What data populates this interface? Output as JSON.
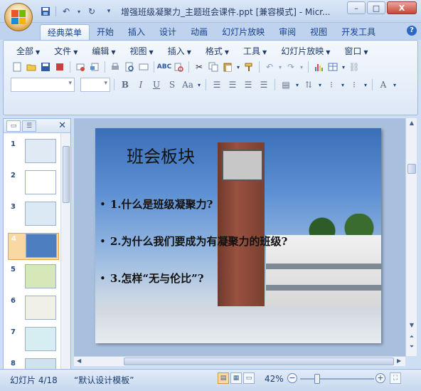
{
  "window": {
    "title": "增强班级凝聚力_主题班会课件.ppt [兼容模式] - Micr...",
    "min_label": "–",
    "max_label": "□",
    "close_label": "X"
  },
  "qat": {
    "save_icon": "save-icon",
    "undo_icon": "undo-icon",
    "redo_icon": "redo-icon"
  },
  "tabs": [
    {
      "label": "经典菜单",
      "active": true
    },
    {
      "label": "开始"
    },
    {
      "label": "插入"
    },
    {
      "label": "设计"
    },
    {
      "label": "动画"
    },
    {
      "label": "幻灯片放映"
    },
    {
      "label": "审阅"
    },
    {
      "label": "视图"
    },
    {
      "label": "开发工具"
    }
  ],
  "menus": [
    {
      "label": "全部"
    },
    {
      "label": "文件"
    },
    {
      "label": "编辑"
    },
    {
      "label": "视图"
    },
    {
      "label": "插入"
    },
    {
      "label": "格式"
    },
    {
      "label": "工具"
    },
    {
      "label": "幻灯片放映"
    },
    {
      "label": "窗口"
    }
  ],
  "format_buttons": {
    "bold": "B",
    "italic": "I",
    "underline": "U",
    "strike": "S",
    "case": "Aa",
    "font_color": "A"
  },
  "panel": {
    "tab_slides": "slides-tab-icon",
    "tab_outline": "outline-tab-icon",
    "close_label": "✕",
    "thumbnails": [
      {
        "num": "1",
        "color": "#dfeaf4"
      },
      {
        "num": "2",
        "color": "#ffffff"
      },
      {
        "num": "3",
        "color": "#dbe9f5"
      },
      {
        "num": "4",
        "color": "#4d7ec0",
        "selected": true
      },
      {
        "num": "5",
        "color": "#d7e8b8"
      },
      {
        "num": "6",
        "color": "#f0f0e8"
      },
      {
        "num": "7",
        "color": "#d6eef2"
      },
      {
        "num": "8",
        "color": "#cfe3ee"
      }
    ]
  },
  "slide": {
    "title": "班会板块",
    "bullets": [
      "1.什么是班级凝聚力?",
      "2.为什么我们要成为有凝聚力的班级?",
      "3.怎样“无与伦比”?"
    ]
  },
  "status": {
    "slide_info": "幻灯片 4/18",
    "template": "“默认设计模板”",
    "zoom": "42%",
    "zoom_level": 0.42
  }
}
